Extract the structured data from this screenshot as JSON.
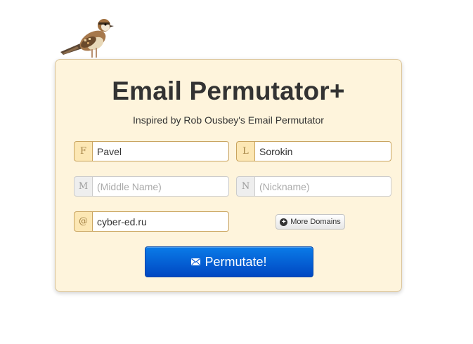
{
  "app": {
    "title": "Email Permutator+",
    "subtitle": "Inspired by Rob Ousbey's Email Permutator"
  },
  "form": {
    "first_name": {
      "addon": "F",
      "value": "Pavel",
      "placeholder": ""
    },
    "last_name": {
      "addon": "L",
      "value": "Sorokin",
      "placeholder": ""
    },
    "middle_name": {
      "addon": "M",
      "value": "",
      "placeholder": "(Middle Name)"
    },
    "nickname": {
      "addon": "N",
      "value": "",
      "placeholder": "(Nickname)"
    },
    "domain": {
      "addon": "@",
      "value": "cyber-ed.ru",
      "placeholder": ""
    }
  },
  "buttons": {
    "more_domains": "More Domains",
    "permutate": "Permutate!"
  },
  "icons": {
    "bird": "bird-icon",
    "plus": "plus-circle-icon",
    "envelope": "envelope-icon"
  },
  "colors": {
    "card_bg": "#fef4dc",
    "addon_bg": "#fce7b4",
    "button_blue": "#0055cc"
  }
}
